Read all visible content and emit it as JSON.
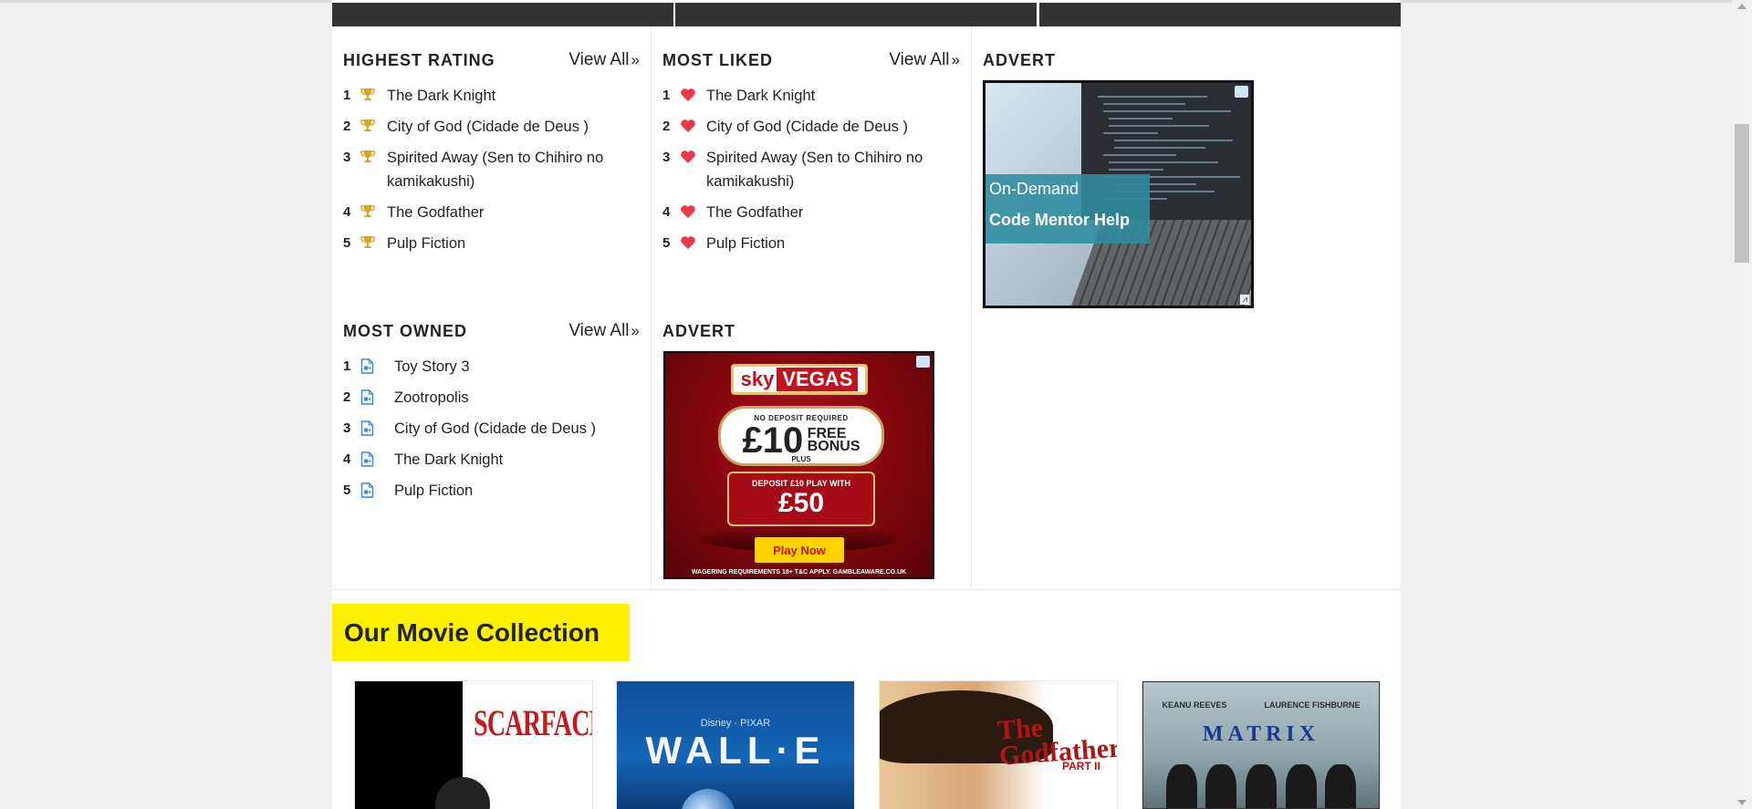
{
  "highest_rating": {
    "title": "HIGHEST RATING",
    "view_all": "View All",
    "items": [
      {
        "rank": "1",
        "label": "The Dark Knight"
      },
      {
        "rank": "2",
        "label": "City of God (Cidade de Deus )"
      },
      {
        "rank": "3",
        "label": "Spirited Away (Sen to Chihiro no kamikakushi)"
      },
      {
        "rank": "4",
        "label": "The Godfather"
      },
      {
        "rank": "5",
        "label": "Pulp Fiction"
      }
    ],
    "icon": "trophy-icon",
    "icon_color": "#d9a520"
  },
  "most_liked": {
    "title": "MOST LIKED",
    "view_all": "View All",
    "items": [
      {
        "rank": "1",
        "label": "The Dark Knight"
      },
      {
        "rank": "2",
        "label": "City of God (Cidade de Deus )"
      },
      {
        "rank": "3",
        "label": "Spirited Away (Sen to Chihiro no kamikakushi)"
      },
      {
        "rank": "4",
        "label": "The Godfather"
      },
      {
        "rank": "5",
        "label": "Pulp Fiction"
      }
    ],
    "icon": "heart-icon",
    "icon_color": "#e8394d"
  },
  "most_owned": {
    "title": "MOST OWNED",
    "view_all": "View All",
    "items": [
      {
        "rank": "1",
        "label": "Toy Story 3"
      },
      {
        "rank": "2",
        "label": "Zootropolis"
      },
      {
        "rank": "3",
        "label": "City of God (Cidade de Deus )"
      },
      {
        "rank": "4",
        "label": "The Dark Knight"
      },
      {
        "rank": "5",
        "label": "Pulp Fiction"
      }
    ],
    "icon": "video-file-icon",
    "icon_color": "#3b86d6"
  },
  "advert_left": {
    "title": "ADVERT",
    "brand_sky": "sky",
    "brand_vegas": "VEGAS",
    "no_deposit": "NO DEPOSIT REQUIRED",
    "amount": "£10",
    "free": "FREE",
    "bonus": "BONUS",
    "plus": "PLUS",
    "deposit_line": "DEPOSIT £10 PLAY WITH",
    "deposit_amount": "£50",
    "cta": "Play Now",
    "terms": "WAGERING REQUIREMENTS 18+ T&C APPLY. GAMBLEAWARE.CO.UK"
  },
  "advert_right": {
    "title": "ADVERT",
    "line1": "On-Demand",
    "line2": "Code Mentor Help"
  },
  "collection": {
    "title": "Our Movie Collection",
    "posters": [
      {
        "title": "SCARFACE"
      },
      {
        "brand": "Disney · PIXAR",
        "title": "WALL·E"
      },
      {
        "title": "The Godfather",
        "part": "PART II"
      },
      {
        "actor1": "KEANU REEVES",
        "actor2": "LAURENCE FISHBURNE",
        "title": "MATRIX"
      }
    ]
  }
}
